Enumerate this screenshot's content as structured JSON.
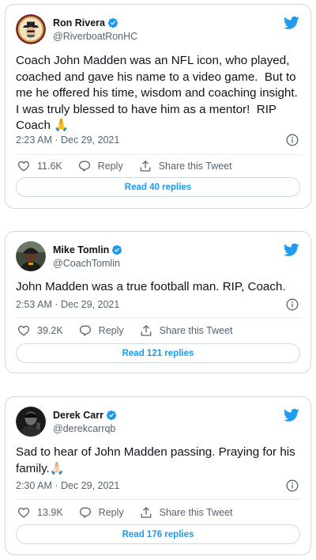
{
  "colors": {
    "accent": "#1d9bf0",
    "text": "#0f1419",
    "secondary": "#536471",
    "border": "#cfd9de"
  },
  "tweets": [
    {
      "name": "Ron Rivera",
      "handle": "@RiverboatRonHC",
      "verified": true,
      "text": "Coach John Madden was an NFL icon, who played, coached and gave his name to a video game.  But to me he offered his time, wisdom and coaching insight. I was truly blessed to have him as a mentor!  RIP Coach 🙏",
      "timestamp": "2:23 AM · Dec 29, 2021",
      "likes": "11.6K",
      "reply_label": "Reply",
      "share_label": "Share this Tweet",
      "read_replies": "Read 40 replies",
      "avatar_icon": "riverboat-ron-logo"
    },
    {
      "name": "Mike Tomlin",
      "handle": "@CoachTomlin",
      "verified": true,
      "text": "John Madden was a true football man. RIP, Coach.",
      "timestamp": "2:53 AM · Dec 29, 2021",
      "likes": "39.2K",
      "reply_label": "Reply",
      "share_label": "Share this Tweet",
      "read_replies": "Read 121 replies",
      "avatar_icon": "profile-photo"
    },
    {
      "name": "Derek Carr",
      "handle": "@derekcarrqb",
      "verified": true,
      "text": "Sad to hear of John Madden passing. Praying for his family.🙏🏻",
      "timestamp": "2:30 AM · Dec 29, 2021",
      "likes": "13.9K",
      "reply_label": "Reply",
      "share_label": "Share this Tweet",
      "read_replies": "Read 176 replies",
      "avatar_icon": "profile-photo"
    }
  ]
}
